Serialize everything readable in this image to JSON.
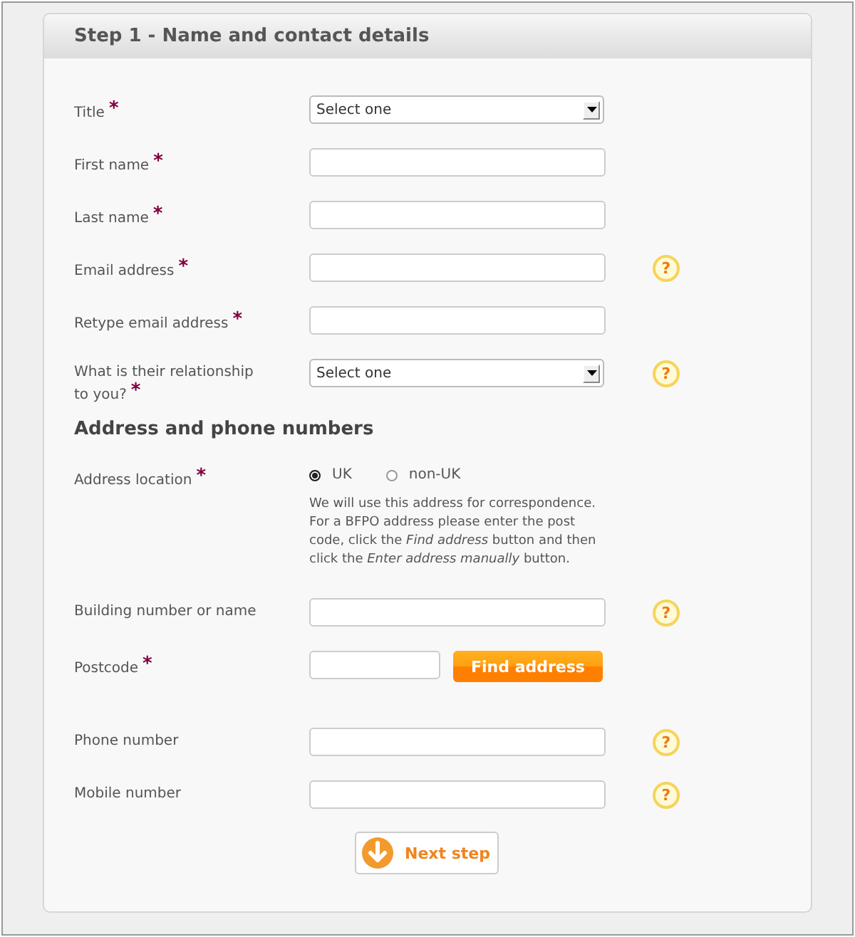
{
  "panel": {
    "title": "Step 1 - Name and contact details"
  },
  "sections": [
    {
      "fields": [
        {
          "kind": "select",
          "label": "Title",
          "marker": "*",
          "value": "Select one"
        },
        {
          "kind": "text",
          "label": "First name",
          "marker": "*"
        },
        {
          "kind": "text",
          "label": "Last name",
          "marker": "*"
        },
        {
          "kind": "text",
          "label": "Email address",
          "marker": "*",
          "help": "?"
        },
        {
          "kind": "text",
          "label": "Retype email address",
          "marker": "*"
        },
        {
          "kind": "select",
          "label": "What is their relationship to you?",
          "marker": "*",
          "value": "Select one",
          "help": "?"
        }
      ]
    },
    {
      "heading": "Address and phone numbers",
      "fields": [
        {
          "kind": "radio",
          "label": "Address location",
          "marker": "*",
          "options": [
            {
              "label": "UK",
              "selected": true
            },
            {
              "label": "non-UK",
              "selected": false
            }
          ],
          "note": "We will use this address for correspondence. For a BFPO address please enter the post code, click the *Find address* button and then click the *Enter address manually* button."
        },
        {
          "kind": "text",
          "label": "Building number or name",
          "help": "?"
        },
        {
          "kind": "postcode",
          "label": "Postcode",
          "marker": "*",
          "button": "Find address"
        },
        {
          "kind": "text",
          "label": "Phone number",
          "help": "?"
        },
        {
          "kind": "text",
          "label": "Mobile number",
          "help": "?"
        }
      ]
    }
  ],
  "next_button": "Next step"
}
